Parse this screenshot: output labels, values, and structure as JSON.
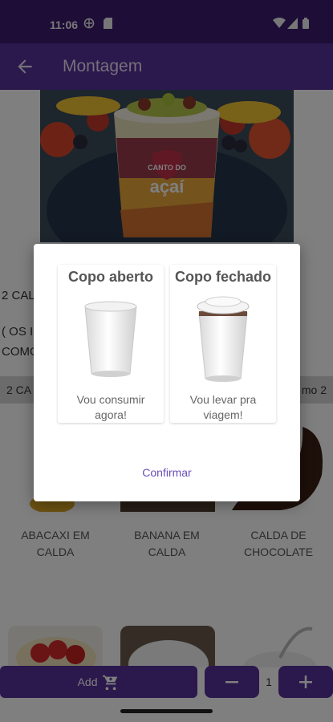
{
  "status_bar": {
    "time": "11:06"
  },
  "app_bar": {
    "title": "Montagem"
  },
  "background": {
    "hero_brand_line1": "CANTO DO",
    "hero_brand_line2": "açaí",
    "side_text_1": "2 CAL",
    "side_text_2": "( OS I",
    "side_text_3": "COMO",
    "section_left": "2 CA",
    "section_right": "mo 2",
    "toppings": [
      {
        "label_line1": "ABACAXI EM",
        "label_line2": "CALDA"
      },
      {
        "label_line1": "BANANA EM",
        "label_line2": "CALDA"
      },
      {
        "label_line1": "CALDA DE",
        "label_line2": "CHOCOLATE"
      }
    ]
  },
  "bottom_bar": {
    "add_label": "Add",
    "quantity": "1",
    "decrement": "−",
    "increment": "+"
  },
  "dialog": {
    "options": [
      {
        "title": "Copo aberto",
        "desc_line1": "Vou consumir",
        "desc_line2": "agora!"
      },
      {
        "title": "Copo fechado",
        "desc_line1": "Vou levar pra",
        "desc_line2": "viagem!"
      }
    ],
    "confirm_label": "Confirmar"
  },
  "colors": {
    "primary": "#56309a",
    "status_bar": "#3a1a6e",
    "link": "#6a4fb8"
  },
  "icons": [
    "arrow-left-icon",
    "cart-icon",
    "minus-icon",
    "plus-icon",
    "wifi-icon",
    "signal-icon",
    "battery-icon"
  ]
}
